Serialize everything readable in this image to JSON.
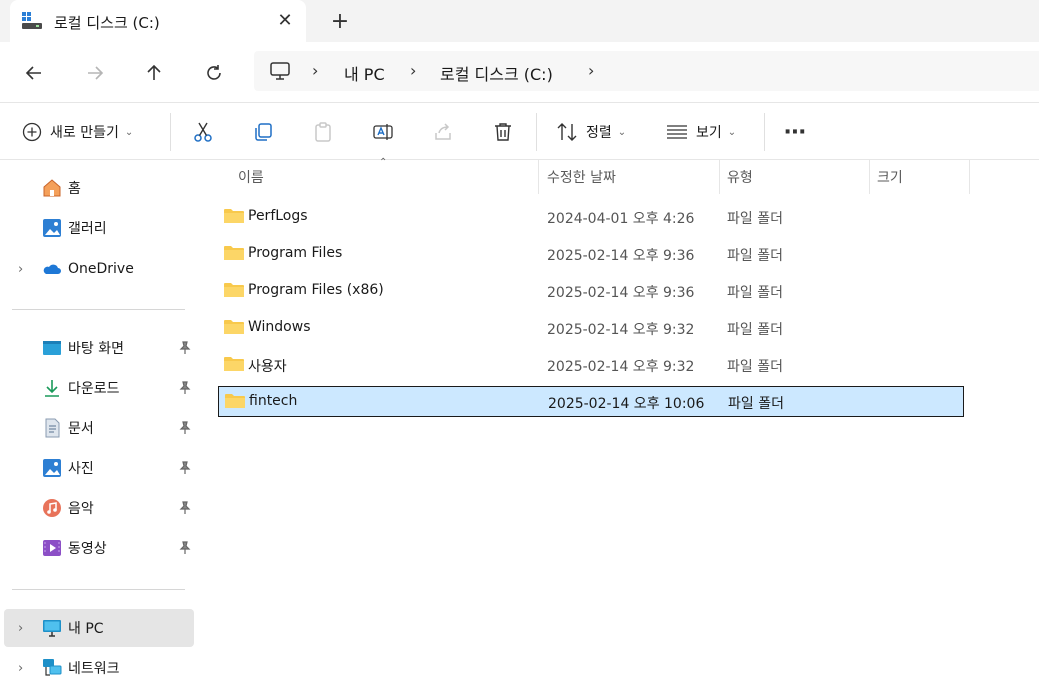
{
  "tab": {
    "title": "로컬 디스크 (C:)",
    "close": "✕",
    "new": "+"
  },
  "nav": {
    "back": "←",
    "forward": "→",
    "up": "↑",
    "refresh": "↻",
    "breadcrumb": [
      "내 PC",
      "로컬 디스크 (C:)"
    ]
  },
  "toolbar": {
    "new_label": "새로 만들기",
    "sort_label": "정렬",
    "view_label": "보기",
    "more": "⋯"
  },
  "sidebar": {
    "quick": [
      {
        "label": "홈",
        "icon": "home-icon"
      },
      {
        "label": "갤러리",
        "icon": "gallery-icon"
      },
      {
        "label": "OneDrive",
        "icon": "onedrive-icon",
        "expandable": true
      }
    ],
    "pinned": [
      {
        "label": "바탕 화면",
        "icon": "desktop-icon"
      },
      {
        "label": "다운로드",
        "icon": "download-icon"
      },
      {
        "label": "문서",
        "icon": "document-icon"
      },
      {
        "label": "사진",
        "icon": "pictures-icon"
      },
      {
        "label": "음악",
        "icon": "music-icon"
      },
      {
        "label": "동영상",
        "icon": "videos-icon"
      }
    ],
    "devices": [
      {
        "label": "내 PC",
        "icon": "this-pc-icon",
        "selected": true
      },
      {
        "label": "네트워크",
        "icon": "network-icon"
      }
    ]
  },
  "columns": {
    "name": "이름",
    "date": "수정한 날짜",
    "type": "유형",
    "size": "크기"
  },
  "files": [
    {
      "name": "PerfLogs",
      "date": "2024-04-01 오후 4:26",
      "type": "파일 폴더"
    },
    {
      "name": "Program Files",
      "date": "2025-02-14 오후 9:36",
      "type": "파일 폴더"
    },
    {
      "name": "Program Files (x86)",
      "date": "2025-02-14 오후 9:36",
      "type": "파일 폴더"
    },
    {
      "name": "Windows",
      "date": "2025-02-14 오후 9:32",
      "type": "파일 폴더"
    },
    {
      "name": "사용자",
      "date": "2025-02-14 오후 9:32",
      "type": "파일 폴더"
    },
    {
      "name": "fintech",
      "date": "2025-02-14 오후 10:06",
      "type": "파일 폴더",
      "selected": true
    }
  ],
  "colors": {
    "folder": "#f8c94c",
    "selection": "#cce8ff",
    "accent": "#0067c0"
  }
}
